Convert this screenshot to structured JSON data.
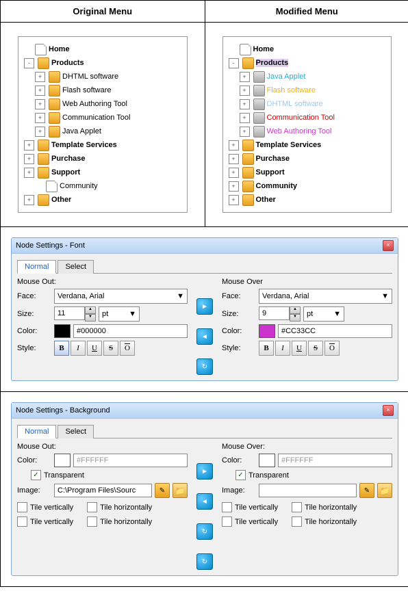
{
  "headers": {
    "original": "Original Menu",
    "modified": "Modified Menu"
  },
  "original_tree": [
    {
      "indent": 0,
      "exp": null,
      "icon": "page",
      "label": "Home",
      "bold": true
    },
    {
      "indent": 0,
      "exp": "-",
      "icon": "folder",
      "label": "Products",
      "bold": true
    },
    {
      "indent": 1,
      "exp": "+",
      "icon": "folder",
      "label": "DHTML software"
    },
    {
      "indent": 1,
      "exp": "+",
      "icon": "folder",
      "label": "Flash software"
    },
    {
      "indent": 1,
      "exp": "+",
      "icon": "folder",
      "label": "Web Authoring Tool"
    },
    {
      "indent": 1,
      "exp": "+",
      "icon": "folder",
      "label": "Communication Tool"
    },
    {
      "indent": 1,
      "exp": "+",
      "icon": "folder",
      "label": "Java Applet"
    },
    {
      "indent": 0,
      "exp": "+",
      "icon": "folder",
      "label": "Template Services",
      "bold": true
    },
    {
      "indent": 0,
      "exp": "+",
      "icon": "folder",
      "label": "Purchase",
      "bold": true
    },
    {
      "indent": 0,
      "exp": "+",
      "icon": "folder",
      "label": "Support",
      "bold": true
    },
    {
      "indent": 1,
      "exp": null,
      "icon": "page",
      "label": "Community"
    },
    {
      "indent": 0,
      "exp": "+",
      "icon": "folder",
      "label": "Other",
      "bold": true
    }
  ],
  "modified_tree": [
    {
      "indent": 0,
      "exp": null,
      "icon": "page",
      "label": "Home",
      "bold": true
    },
    {
      "indent": 0,
      "exp": "-",
      "icon": "folder",
      "label": "Products",
      "bold": true,
      "hl": true
    },
    {
      "indent": 1,
      "exp": "+",
      "icon": "folder-grey",
      "label": "Java Applet",
      "color": "#20b0d0"
    },
    {
      "indent": 1,
      "exp": "+",
      "icon": "folder-grey",
      "label": "Flash software",
      "color": "#f0b020"
    },
    {
      "indent": 1,
      "exp": "+",
      "icon": "folder-grey",
      "label": "DHTML software",
      "color": "#a0c8e8"
    },
    {
      "indent": 1,
      "exp": "+",
      "icon": "folder-grey",
      "label": "Communication Tool",
      "color": "#d00000"
    },
    {
      "indent": 1,
      "exp": "+",
      "icon": "folder-grey",
      "label": "Web Authoring Tool",
      "color": "#cc33cc"
    },
    {
      "indent": 0,
      "exp": "+",
      "icon": "folder",
      "label": "Template Services",
      "bold": true
    },
    {
      "indent": 0,
      "exp": "+",
      "icon": "folder",
      "label": "Purchase",
      "bold": true
    },
    {
      "indent": 0,
      "exp": "+",
      "icon": "folder",
      "label": "Support",
      "bold": true
    },
    {
      "indent": 0,
      "exp": "+",
      "icon": "folder",
      "label": "Community",
      "bold": true
    },
    {
      "indent": 0,
      "exp": "+",
      "icon": "folder",
      "label": "Other",
      "bold": true
    }
  ],
  "font_panel": {
    "title": "Node Settings - Font",
    "tabs": {
      "normal": "Normal",
      "select": "Select"
    },
    "labels": {
      "mouseout": "Mouse Out:",
      "mouseover": "Mouse Over",
      "face": "Face:",
      "size": "Size:",
      "color": "Color:",
      "style": "Style:"
    },
    "out": {
      "face": "Verdana, Arial",
      "size": "11",
      "unit": "pt",
      "color": "#000000",
      "swatch": "#000000",
      "bold_active": true
    },
    "over": {
      "face": "Verdana, Arial",
      "size": "9",
      "unit": "pt",
      "color": "#CC33CC",
      "swatch": "#CC33CC",
      "bold_active": false
    }
  },
  "bg_panel": {
    "title": "Node Settings - Background",
    "tabs": {
      "normal": "Normal",
      "select": "Select"
    },
    "labels": {
      "mouseout": "Mouse Out:",
      "mouseover": "Mouse Over:",
      "color": "Color:",
      "transparent": "Transparent",
      "image": "Image:",
      "tilev": "Tile vertically",
      "tileh": "Tile horizontally"
    },
    "out": {
      "color": "#FFFFFF",
      "transparent": true,
      "image": "C:\\Program Files\\Sourc"
    },
    "over": {
      "color": "#FFFFFF",
      "transparent": true,
      "image": ""
    }
  }
}
